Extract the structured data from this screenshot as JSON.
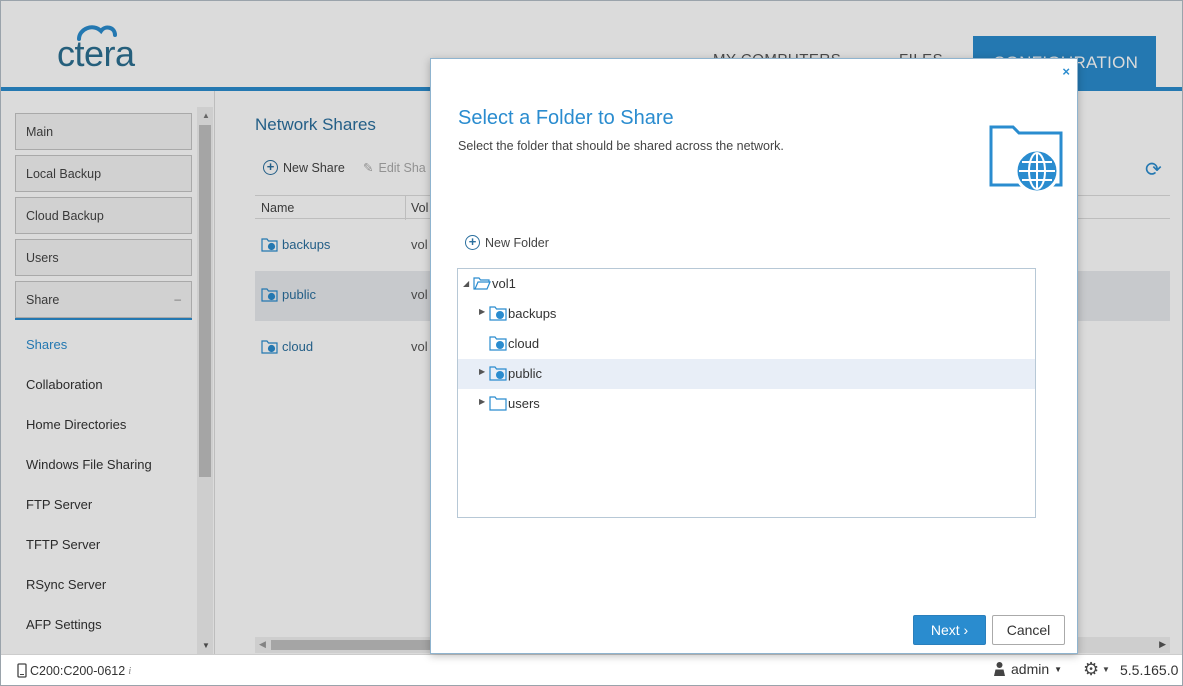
{
  "header": {
    "logo_text": "ctera",
    "nav": {
      "my_computers": "MY COMPUTERS",
      "files": "FILES",
      "configuration": "CONFIGURATION"
    }
  },
  "sidebar": {
    "main": "Main",
    "local_backup": "Local Backup",
    "cloud_backup": "Cloud Backup",
    "users": "Users",
    "share": "Share",
    "share_collapse": "–",
    "sub_items": {
      "shares": "Shares",
      "collaboration": "Collaboration",
      "home_directories": "Home Directories",
      "windows_file_sharing": "Windows File Sharing",
      "ftp_server": "FTP Server",
      "tftp_server": "TFTP Server",
      "rsync_server": "RSync Server",
      "afp_settings": "AFP Settings"
    }
  },
  "main": {
    "title": "Network Shares",
    "toolbar": {
      "new_share": "New Share",
      "edit_share": "Edit Sha"
    },
    "columns": {
      "name": "Name",
      "volume": "Vol"
    },
    "rows": [
      {
        "name": "backups",
        "volume": "vol"
      },
      {
        "name": "public",
        "volume": "vol"
      },
      {
        "name": "cloud",
        "volume": "vol"
      }
    ]
  },
  "footer": {
    "device": "C200:C200-0612",
    "info": "i",
    "user": "admin",
    "version": "5.5.165.0"
  },
  "dialog": {
    "title": "Select a Folder to Share",
    "subtitle": "Select the folder that should be shared across the network.",
    "close": "×",
    "new_folder": "New Folder",
    "tree": {
      "root": "vol1",
      "children": [
        {
          "label": "backups"
        },
        {
          "label": "cloud"
        },
        {
          "label": "public"
        },
        {
          "label": "users"
        }
      ]
    },
    "next": "Next ›",
    "cancel": "Cancel"
  },
  "colors": {
    "accent": "#2a8ccf",
    "title_blue": "#2a6f9e"
  }
}
